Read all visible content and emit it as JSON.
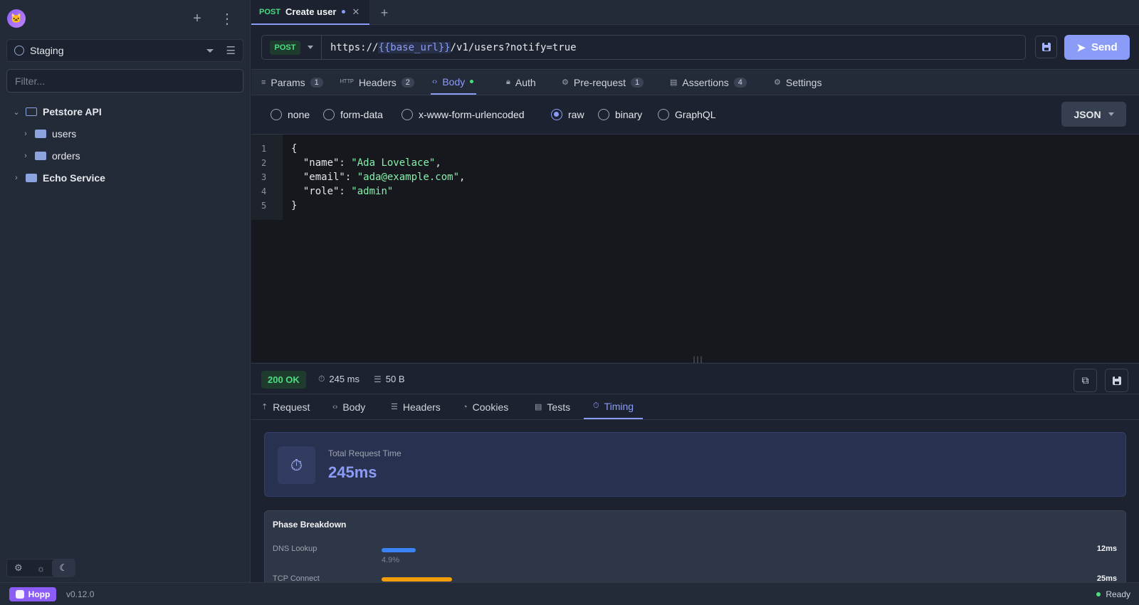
{
  "sidebar": {
    "environment": "Staging",
    "filter_placeholder": "Filter...",
    "tree": [
      {
        "label": "Petstore API"
      },
      {
        "label": "users"
      },
      {
        "label": "orders"
      },
      {
        "label": "Echo Service"
      }
    ]
  },
  "tab": {
    "method": "POST",
    "title": "Create user"
  },
  "request": {
    "method": "POST",
    "url_prefix": "https://",
    "url_var": "{{base_url}}",
    "url_suffix": "/v1/users?notify=true",
    "send_label": "Send"
  },
  "request_tabs": [
    {
      "label": "Params",
      "count": "1"
    },
    {
      "label": "Headers",
      "count": "2"
    },
    {
      "label": "Body"
    },
    {
      "label": "Auth"
    },
    {
      "label": "Pre-request",
      "count": "1"
    },
    {
      "label": "Assertions",
      "count": "4"
    },
    {
      "label": "Settings"
    }
  ],
  "body_types": [
    "none",
    "form-data",
    "x-www-form-urlencoded",
    "raw",
    "binary",
    "GraphQL"
  ],
  "body_selected": "raw",
  "content_type": "JSON",
  "code_lines": [
    {
      "num": "1",
      "plain": "{",
      "key": "",
      "str": "",
      "tail": ""
    },
    {
      "num": "2",
      "plain": "  \"name\": ",
      "str": "\"Ada Lovelace\"",
      "tail": ","
    },
    {
      "num": "3",
      "plain": "  \"email\": ",
      "str": "\"ada@example.com\"",
      "tail": ","
    },
    {
      "num": "4",
      "plain": "  \"role\": ",
      "str": "\"admin\"",
      "tail": ""
    },
    {
      "num": "5",
      "plain": "}",
      "str": "",
      "tail": ""
    }
  ],
  "response": {
    "status": "200 OK",
    "time": "245 ms",
    "size": "50 B"
  },
  "response_tabs": [
    "Request",
    "Body",
    "Headers",
    "Cookies",
    "Tests",
    "Timing"
  ],
  "timing": {
    "total_label": "Total Request Time",
    "total_value": "245ms",
    "breakdown_title": "Phase Breakdown",
    "phases": [
      {
        "name": "DNS Lookup",
        "pct": "4.9%",
        "ms": "12ms",
        "fraction": 0.049,
        "color": "#3b82f6"
      },
      {
        "name": "TCP Connect",
        "pct": "",
        "ms": "25ms",
        "fraction": 0.102,
        "color": "#f59e0b"
      }
    ]
  },
  "footer": {
    "brand": "Hopp",
    "version": "v0.12.0",
    "status": "Ready"
  }
}
